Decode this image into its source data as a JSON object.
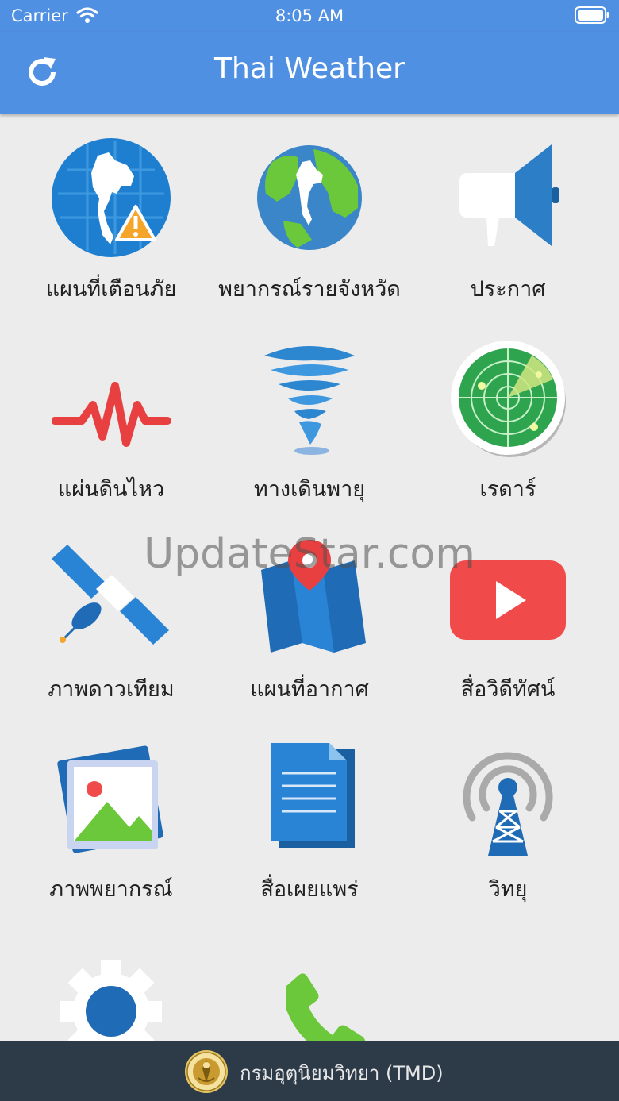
{
  "status_bar": {
    "carrier": "Carrier",
    "time": "8:05 AM"
  },
  "header": {
    "title": "Thai Weather"
  },
  "menu": {
    "items": [
      {
        "label": "แผนที่เตือนภัย",
        "icon": "thailand-warning-map-icon"
      },
      {
        "label": "พยากรณ์รายจังหวัด",
        "icon": "globe-icon"
      },
      {
        "label": "ประกาศ",
        "icon": "megaphone-icon"
      },
      {
        "label": "แผ่นดินไหว",
        "icon": "seismograph-icon"
      },
      {
        "label": "ทางเดินพายุ",
        "icon": "tornado-icon"
      },
      {
        "label": "เรดาร์",
        "icon": "radar-icon"
      },
      {
        "label": "ภาพดาวเทียม",
        "icon": "satellite-icon"
      },
      {
        "label": "แผนที่อากาศ",
        "icon": "map-pin-icon"
      },
      {
        "label": "สื่อวิดีทัศน์",
        "icon": "video-play-icon"
      },
      {
        "label": "ภาพพยากรณ์",
        "icon": "image-icon"
      },
      {
        "label": "สื่อเผยแพร่",
        "icon": "document-icon"
      },
      {
        "label": "วิทยุ",
        "icon": "radio-tower-icon"
      },
      {
        "label": "",
        "icon": "gear-icon"
      },
      {
        "label": "",
        "icon": "phone-icon"
      }
    ]
  },
  "watermark": "UpdateStar.com",
  "footer": {
    "org": "กรมอุตุนิยมวิทยา (TMD)"
  },
  "colors": {
    "header": "#5090e2",
    "footer": "#2d3a48",
    "background": "#ececec"
  }
}
